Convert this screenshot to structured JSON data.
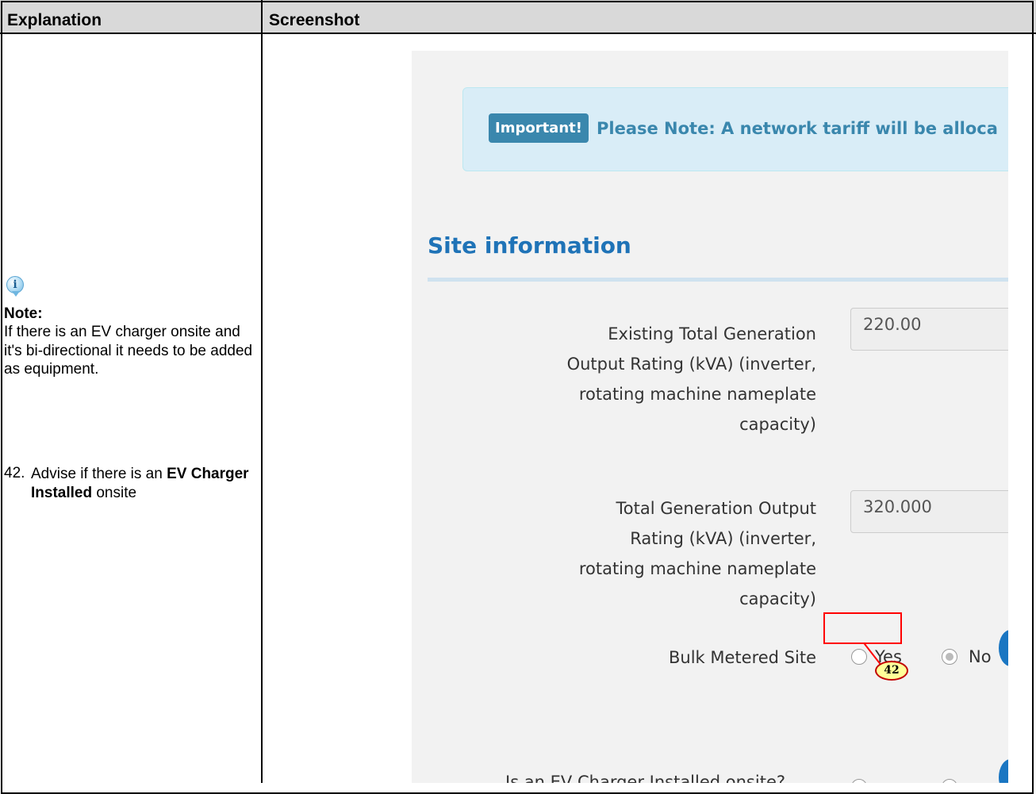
{
  "table": {
    "header": {
      "explanation": "Explanation",
      "screenshot": "Screenshot"
    }
  },
  "explanation": {
    "info_icon": "info-icon",
    "note_title": "Note:",
    "note_body": "If there is an EV charger onsite and it's bi-directional it needs to be added as equipment.",
    "step": {
      "number": "42.",
      "text_before": "Advise if there is an ",
      "text_bold": "EV Charger Installed",
      "text_after": " onsite"
    }
  },
  "screenshot": {
    "alert": {
      "badge": "Important!",
      "text": "Please Note: A network tariff will be alloca"
    },
    "section_title": "Site information",
    "fields": {
      "existing_generation": {
        "label": "Existing Total Generation Output Rating (kVA) (inverter, rotating machine nameplate capacity)",
        "value": "220.00"
      },
      "total_generation": {
        "label": "Total Generation Output Rating (kVA) (inverter, rotating machine nameplate capacity)",
        "value": "320.000"
      },
      "bulk_metered": {
        "label": "Bulk Metered Site",
        "options": [
          "Yes",
          "No"
        ],
        "selected": "No"
      },
      "ev_charger_partial_label": "Is an EV Charger Installed onsite?"
    }
  },
  "annotation": {
    "step_badge": "42",
    "highlight_color": "#ff0000",
    "badge_color": "#ffff99"
  }
}
